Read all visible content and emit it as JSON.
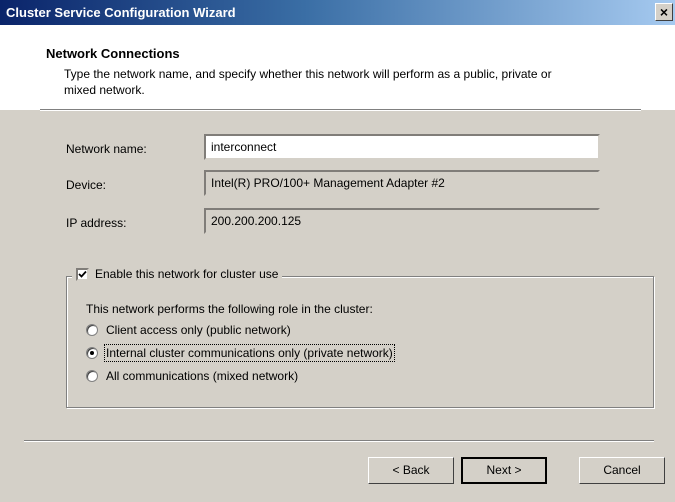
{
  "window": {
    "title": "Cluster Service Configuration Wizard",
    "close_glyph": "×"
  },
  "header": {
    "title": "Network Connections",
    "subtitle": "Type the network name, and specify whether this network will perform as a public, private or mixed network."
  },
  "form": {
    "network_name_label": "Network name:",
    "network_name_value": "interconnect",
    "device_label": "Device:",
    "device_value": "Intel(R) PRO/100+ Management Adapter #2",
    "ip_label": "IP address:",
    "ip_value": "200.200.200.125"
  },
  "cluster_use": {
    "checkbox_label": "Enable this network for cluster use",
    "checked": true,
    "role_prompt": "This network performs the following role in the cluster:",
    "options": [
      {
        "label": "Client access only (public network)",
        "selected": false
      },
      {
        "label": "Internal cluster communications only (private network)",
        "selected": true
      },
      {
        "label": "All communications (mixed network)",
        "selected": false
      }
    ]
  },
  "buttons": {
    "back": "< Back",
    "next": "Next >",
    "cancel": "Cancel"
  }
}
